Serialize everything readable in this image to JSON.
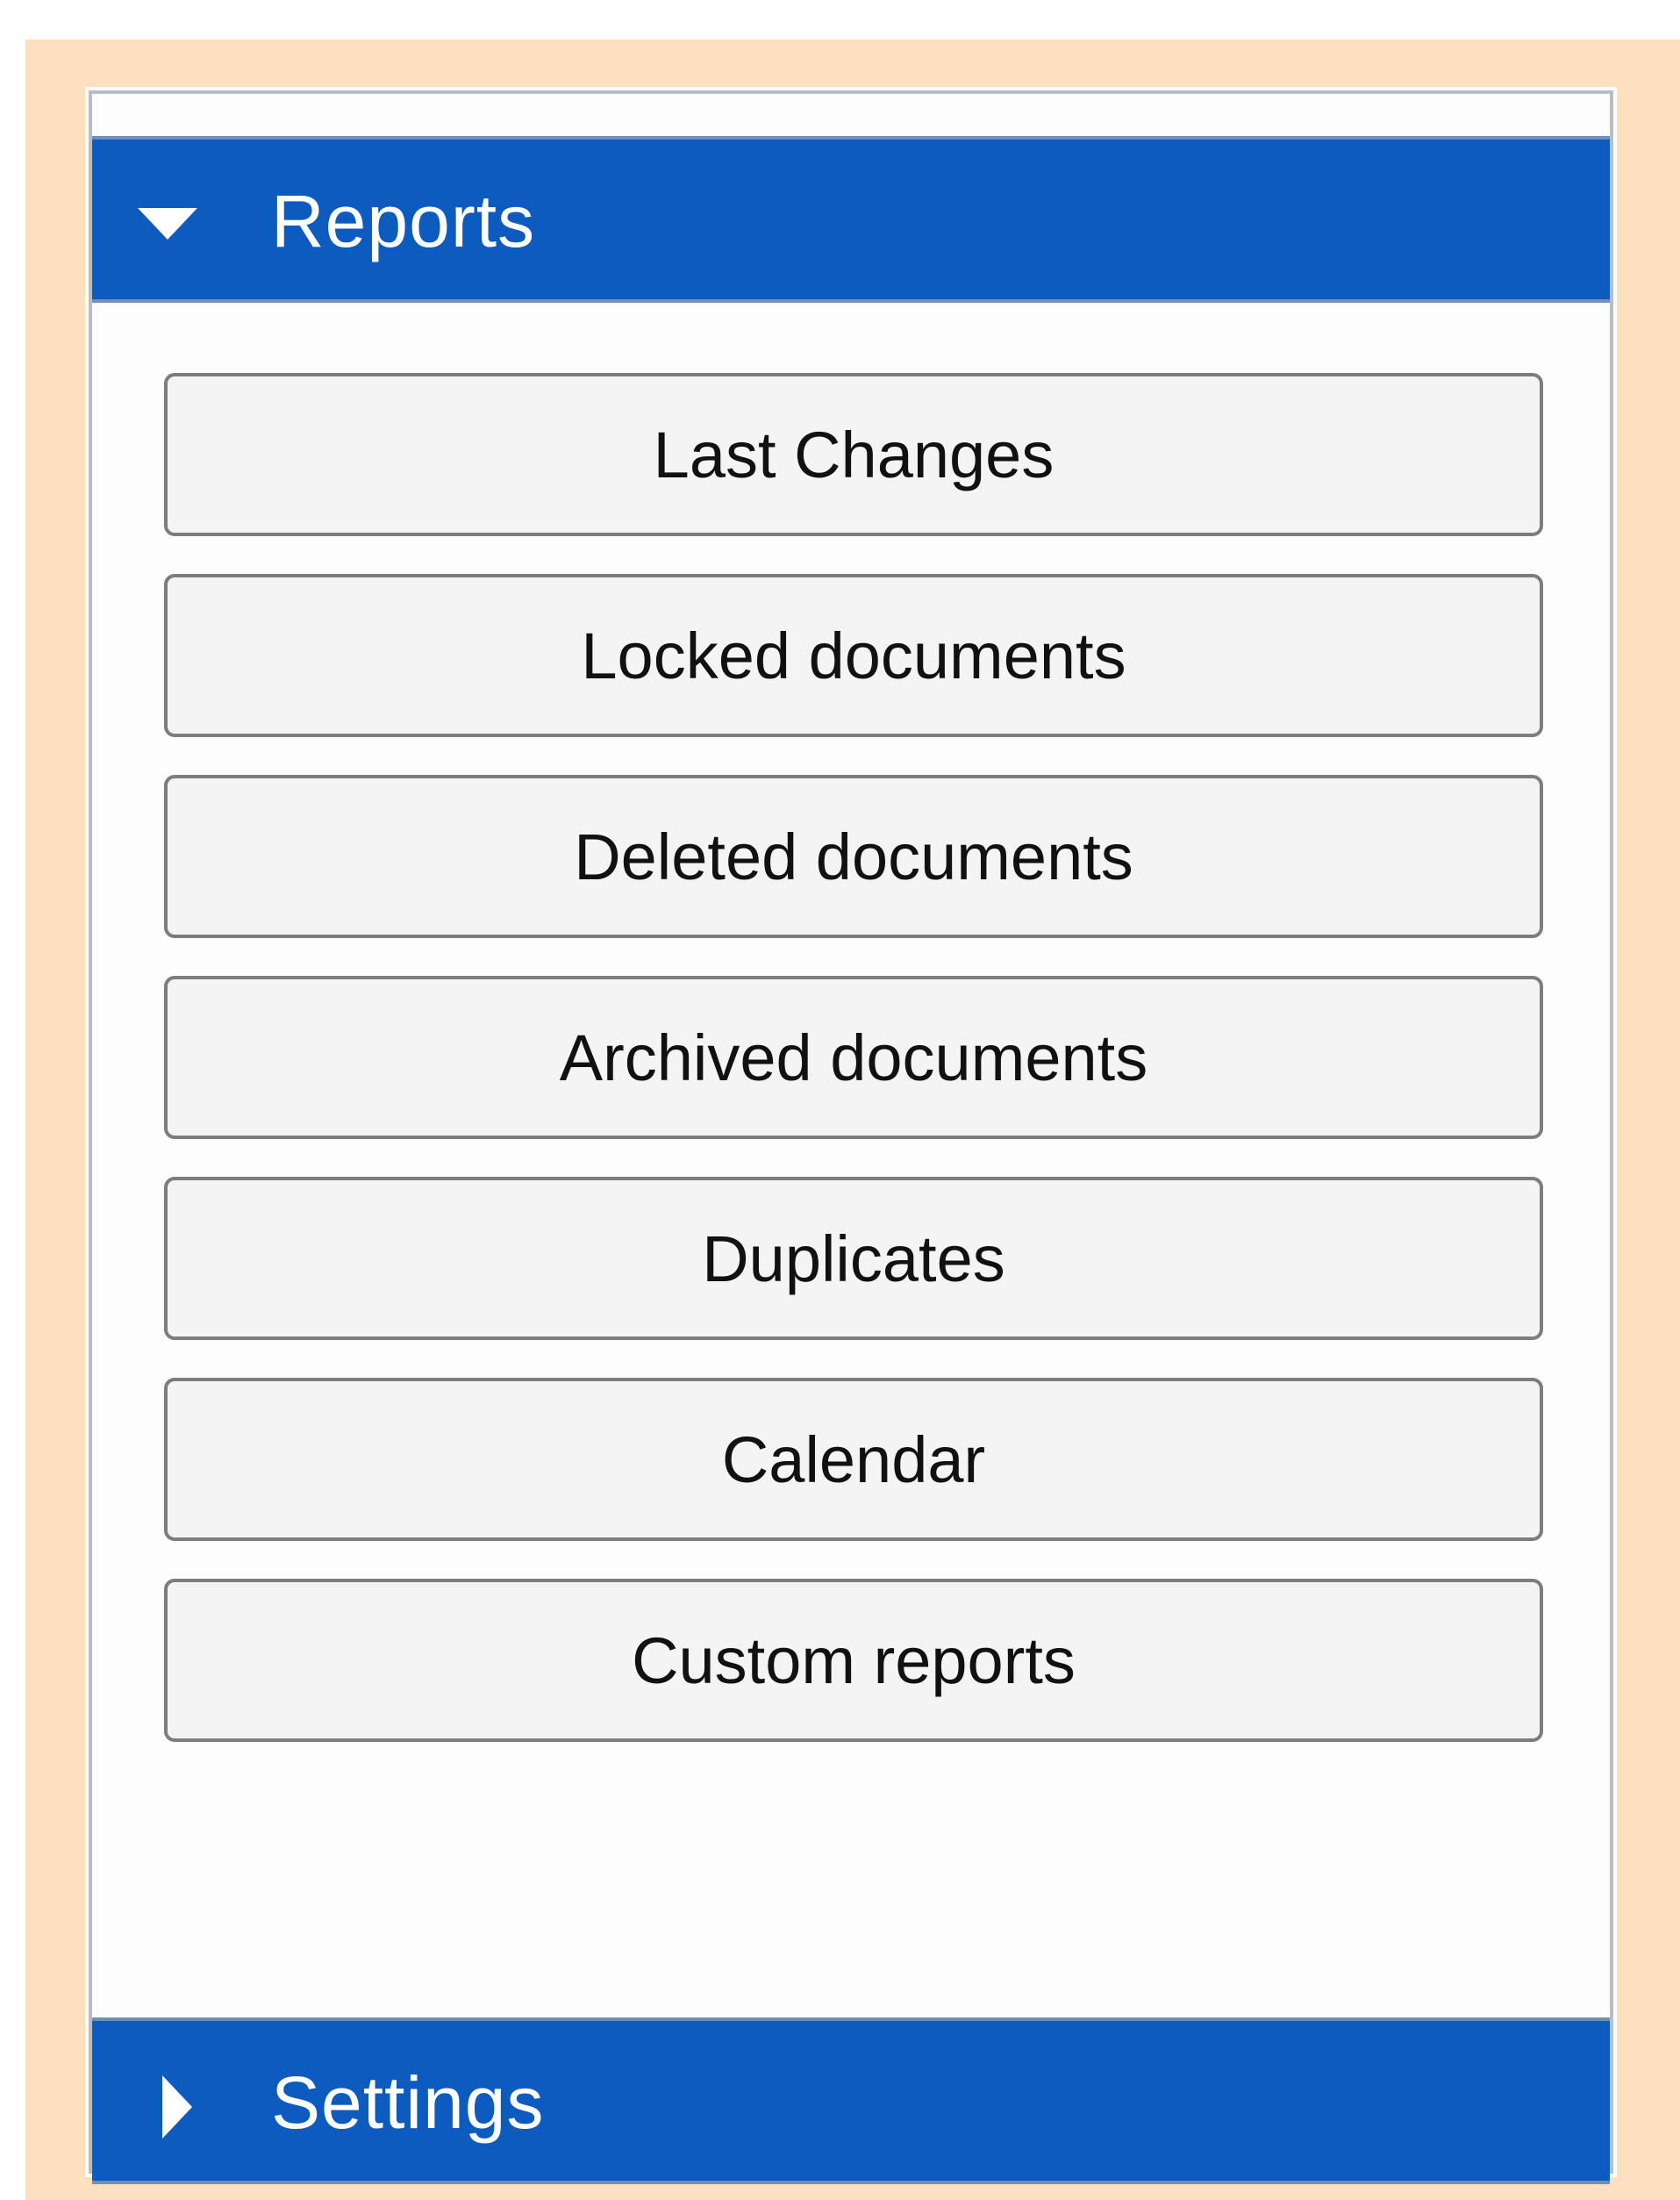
{
  "reports_section": {
    "title": "Reports",
    "expanded": true,
    "toggle_icon": "caret-down-icon",
    "buttons": [
      "Last Changes",
      "Locked documents",
      "Deleted documents",
      "Archived documents",
      "Duplicates",
      "Calendar",
      "Custom reports"
    ]
  },
  "settings_section": {
    "title": "Settings",
    "expanded": false,
    "toggle_icon": "caret-right-icon"
  },
  "colors": {
    "outer_background": "#fde0c0",
    "header_background": "#0e5bbf",
    "button_background": "#f4f4f4",
    "button_border": "#7d7d7d"
  }
}
